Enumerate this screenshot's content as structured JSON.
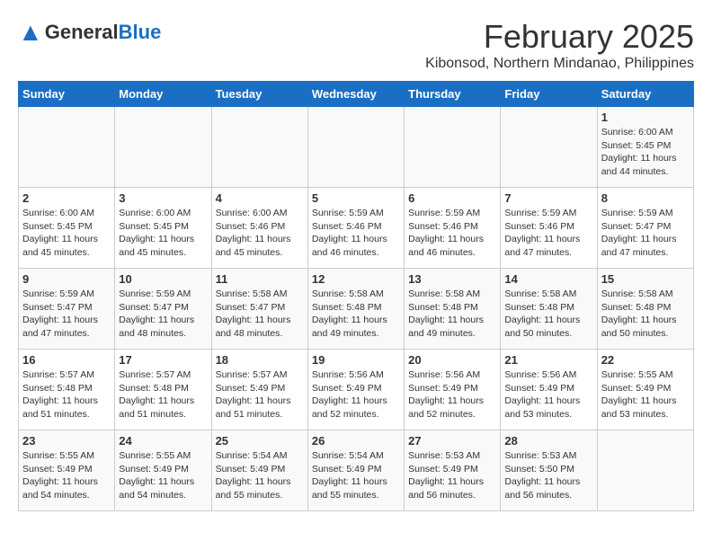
{
  "header": {
    "logo_general": "General",
    "logo_blue": "Blue",
    "month": "February 2025",
    "location": "Kibonsod, Northern Mindanao, Philippines"
  },
  "weekdays": [
    "Sunday",
    "Monday",
    "Tuesday",
    "Wednesday",
    "Thursday",
    "Friday",
    "Saturday"
  ],
  "weeks": [
    [
      {
        "day": "",
        "info": ""
      },
      {
        "day": "",
        "info": ""
      },
      {
        "day": "",
        "info": ""
      },
      {
        "day": "",
        "info": ""
      },
      {
        "day": "",
        "info": ""
      },
      {
        "day": "",
        "info": ""
      },
      {
        "day": "1",
        "info": "Sunrise: 6:00 AM\nSunset: 5:45 PM\nDaylight: 11 hours\nand 44 minutes."
      }
    ],
    [
      {
        "day": "2",
        "info": "Sunrise: 6:00 AM\nSunset: 5:45 PM\nDaylight: 11 hours\nand 45 minutes."
      },
      {
        "day": "3",
        "info": "Sunrise: 6:00 AM\nSunset: 5:45 PM\nDaylight: 11 hours\nand 45 minutes."
      },
      {
        "day": "4",
        "info": "Sunrise: 6:00 AM\nSunset: 5:46 PM\nDaylight: 11 hours\nand 45 minutes."
      },
      {
        "day": "5",
        "info": "Sunrise: 5:59 AM\nSunset: 5:46 PM\nDaylight: 11 hours\nand 46 minutes."
      },
      {
        "day": "6",
        "info": "Sunrise: 5:59 AM\nSunset: 5:46 PM\nDaylight: 11 hours\nand 46 minutes."
      },
      {
        "day": "7",
        "info": "Sunrise: 5:59 AM\nSunset: 5:46 PM\nDaylight: 11 hours\nand 47 minutes."
      },
      {
        "day": "8",
        "info": "Sunrise: 5:59 AM\nSunset: 5:47 PM\nDaylight: 11 hours\nand 47 minutes."
      }
    ],
    [
      {
        "day": "9",
        "info": "Sunrise: 5:59 AM\nSunset: 5:47 PM\nDaylight: 11 hours\nand 47 minutes."
      },
      {
        "day": "10",
        "info": "Sunrise: 5:59 AM\nSunset: 5:47 PM\nDaylight: 11 hours\nand 48 minutes."
      },
      {
        "day": "11",
        "info": "Sunrise: 5:58 AM\nSunset: 5:47 PM\nDaylight: 11 hours\nand 48 minutes."
      },
      {
        "day": "12",
        "info": "Sunrise: 5:58 AM\nSunset: 5:48 PM\nDaylight: 11 hours\nand 49 minutes."
      },
      {
        "day": "13",
        "info": "Sunrise: 5:58 AM\nSunset: 5:48 PM\nDaylight: 11 hours\nand 49 minutes."
      },
      {
        "day": "14",
        "info": "Sunrise: 5:58 AM\nSunset: 5:48 PM\nDaylight: 11 hours\nand 50 minutes."
      },
      {
        "day": "15",
        "info": "Sunrise: 5:58 AM\nSunset: 5:48 PM\nDaylight: 11 hours\nand 50 minutes."
      }
    ],
    [
      {
        "day": "16",
        "info": "Sunrise: 5:57 AM\nSunset: 5:48 PM\nDaylight: 11 hours\nand 51 minutes."
      },
      {
        "day": "17",
        "info": "Sunrise: 5:57 AM\nSunset: 5:48 PM\nDaylight: 11 hours\nand 51 minutes."
      },
      {
        "day": "18",
        "info": "Sunrise: 5:57 AM\nSunset: 5:49 PM\nDaylight: 11 hours\nand 51 minutes."
      },
      {
        "day": "19",
        "info": "Sunrise: 5:56 AM\nSunset: 5:49 PM\nDaylight: 11 hours\nand 52 minutes."
      },
      {
        "day": "20",
        "info": "Sunrise: 5:56 AM\nSunset: 5:49 PM\nDaylight: 11 hours\nand 52 minutes."
      },
      {
        "day": "21",
        "info": "Sunrise: 5:56 AM\nSunset: 5:49 PM\nDaylight: 11 hours\nand 53 minutes."
      },
      {
        "day": "22",
        "info": "Sunrise: 5:55 AM\nSunset: 5:49 PM\nDaylight: 11 hours\nand 53 minutes."
      }
    ],
    [
      {
        "day": "23",
        "info": "Sunrise: 5:55 AM\nSunset: 5:49 PM\nDaylight: 11 hours\nand 54 minutes."
      },
      {
        "day": "24",
        "info": "Sunrise: 5:55 AM\nSunset: 5:49 PM\nDaylight: 11 hours\nand 54 minutes."
      },
      {
        "day": "25",
        "info": "Sunrise: 5:54 AM\nSunset: 5:49 PM\nDaylight: 11 hours\nand 55 minutes."
      },
      {
        "day": "26",
        "info": "Sunrise: 5:54 AM\nSunset: 5:49 PM\nDaylight: 11 hours\nand 55 minutes."
      },
      {
        "day": "27",
        "info": "Sunrise: 5:53 AM\nSunset: 5:49 PM\nDaylight: 11 hours\nand 56 minutes."
      },
      {
        "day": "28",
        "info": "Sunrise: 5:53 AM\nSunset: 5:50 PM\nDaylight: 11 hours\nand 56 minutes."
      },
      {
        "day": "",
        "info": ""
      }
    ]
  ]
}
